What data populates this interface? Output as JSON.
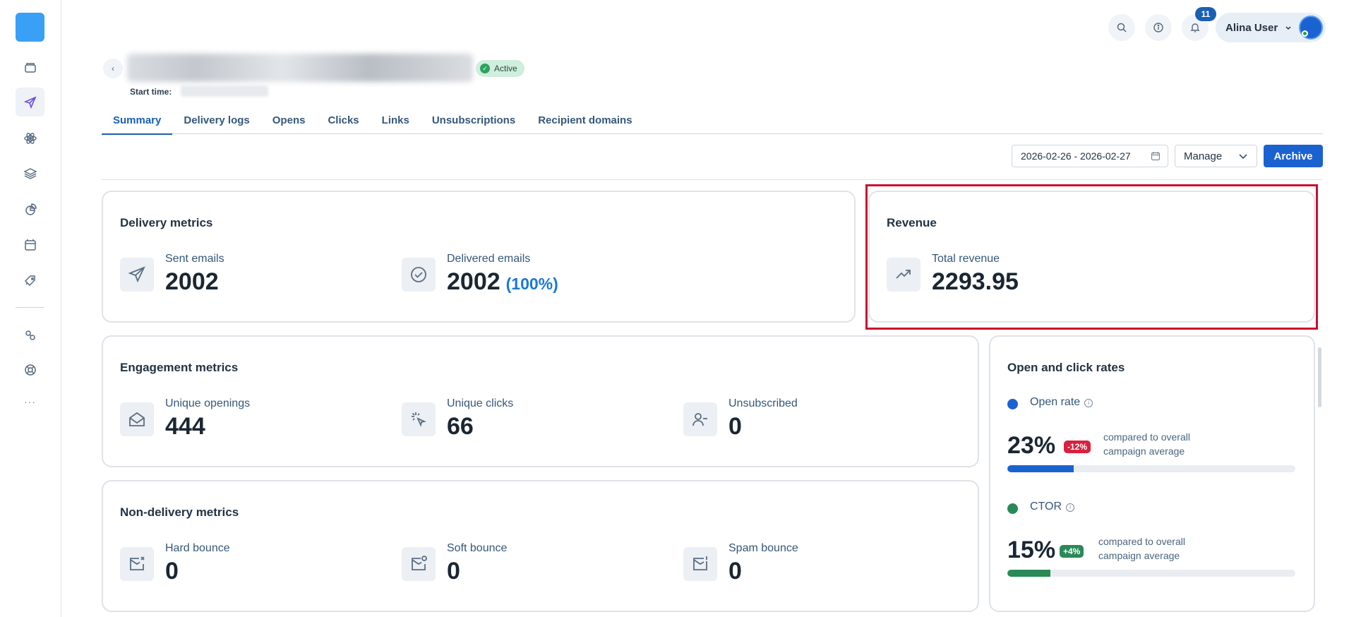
{
  "sidebar": {
    "items": [
      {
        "icon": "folder-icon"
      },
      {
        "icon": "paper-plane-icon"
      },
      {
        "icon": "atom-icon"
      },
      {
        "icon": "layers-icon"
      },
      {
        "icon": "pie-chart-icon"
      },
      {
        "icon": "templates-icon"
      },
      {
        "icon": "tag-icon"
      },
      {
        "icon": "integrations-icon"
      },
      {
        "icon": "support-icon"
      }
    ],
    "more_label": "···"
  },
  "topbar": {
    "notification_count": "11",
    "user_name": "Alina User"
  },
  "campaign": {
    "status": "Active",
    "start_time_label": "Start time:"
  },
  "tabs": [
    "Summary",
    "Delivery logs",
    "Opens",
    "Clicks",
    "Links",
    "Unsubscriptions",
    "Recipient domains"
  ],
  "toolbar": {
    "date_range": "2026-02-26 - 2026-02-27",
    "manage_label": "Manage",
    "archive_label": "Archive"
  },
  "delivery": {
    "title": "Delivery metrics",
    "sent_label": "Sent emails",
    "sent_value": "2002",
    "delivered_label": "Delivered emails",
    "delivered_value": "2002",
    "delivered_pct": "(100%)"
  },
  "revenue": {
    "title": "Revenue",
    "total_label": "Total revenue",
    "total_value": "2293.95"
  },
  "engagement": {
    "title": "Engagement metrics",
    "openings_label": "Unique openings",
    "openings_value": "444",
    "clicks_label": "Unique clicks",
    "clicks_value": "66",
    "unsub_label": "Unsubscribed",
    "unsub_value": "0"
  },
  "nondelivery": {
    "title": "Non-delivery metrics",
    "hard_label": "Hard bounce",
    "hard_value": "0",
    "soft_label": "Soft bounce",
    "soft_value": "0",
    "spam_label": "Spam bounce",
    "spam_value": "0"
  },
  "rates": {
    "title": "Open and click rates",
    "open": {
      "name": "Open rate",
      "value": "23%",
      "delta": "-12%",
      "compare": "compared to overall campaign average",
      "fraction": 0.23,
      "color": "#1b62d1",
      "delta_color": "#d6213f"
    },
    "ctor": {
      "name": "CTOR",
      "value": "15%",
      "delta": "+4%",
      "compare": "compared to overall campaign average",
      "fraction": 0.15,
      "color": "#2a8a57",
      "delta_color": "#2a8a57"
    }
  },
  "colors": {
    "primary": "#1b62d1",
    "active_badge": "#cfeedd",
    "highlight": "#c8102e"
  }
}
